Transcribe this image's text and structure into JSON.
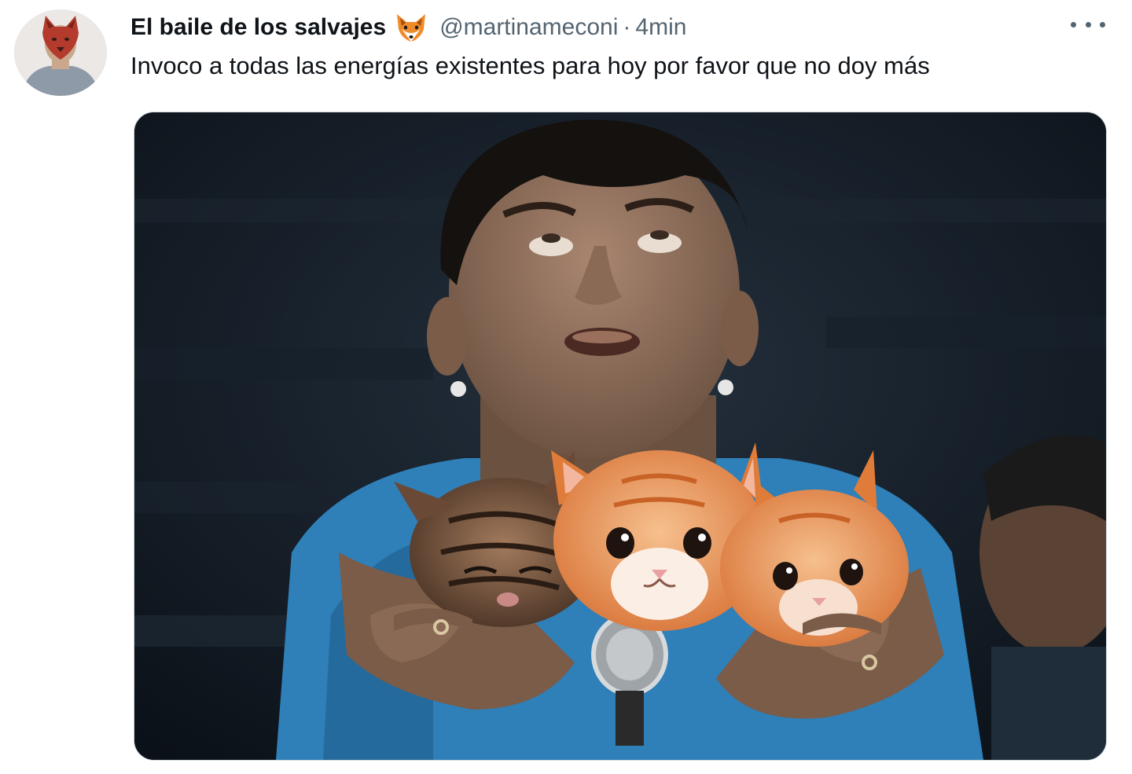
{
  "tweet": {
    "display_name": "El baile de los salvajes",
    "name_emoji": "fox-icon",
    "handle": "@martinameconi",
    "separator": "·",
    "timestamp": "4min",
    "text": "Invoco a todas las energías existentes para hoy por favor que no doy más",
    "more_icon": "more-options-icon",
    "media_alt": "tweet-photo"
  },
  "colors": {
    "text": "#0f1419",
    "secondary": "#536471",
    "border": "#cfd9de"
  }
}
